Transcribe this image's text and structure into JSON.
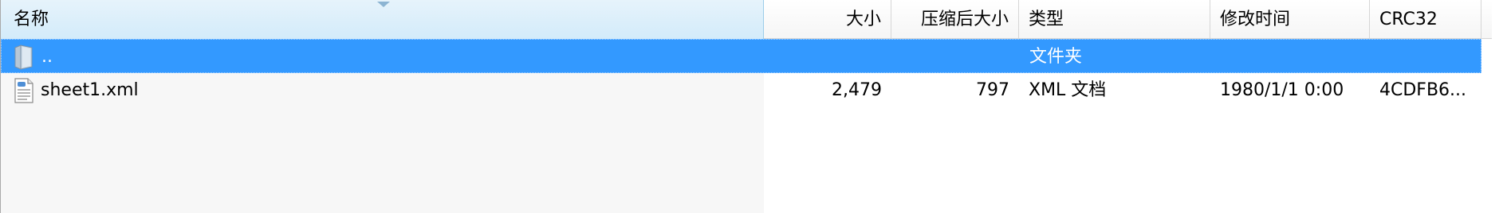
{
  "columns": [
    {
      "key": "name",
      "label": "名称"
    },
    {
      "key": "size",
      "label": "大小"
    },
    {
      "key": "packed",
      "label": "压缩后大小"
    },
    {
      "key": "type",
      "label": "类型"
    },
    {
      "key": "modified",
      "label": "修改时间"
    },
    {
      "key": "crc",
      "label": "CRC32"
    }
  ],
  "rows": [
    {
      "icon": "folder-up-icon",
      "name": "..",
      "size": "",
      "packed": "",
      "type": "文件夹",
      "modified": "",
      "crc": "",
      "selected": true
    },
    {
      "icon": "xml-file-icon",
      "name": "sheet1.xml",
      "size": "2,479",
      "packed": "797",
      "type": "XML 文档",
      "modified": "1980/1/1 0:00",
      "crc": "4CDFB6..."
    }
  ],
  "colors": {
    "selection": "#3399ff",
    "header_sorted": "#d3ebfa",
    "sorted_column_bg": "#f7f7f7"
  }
}
